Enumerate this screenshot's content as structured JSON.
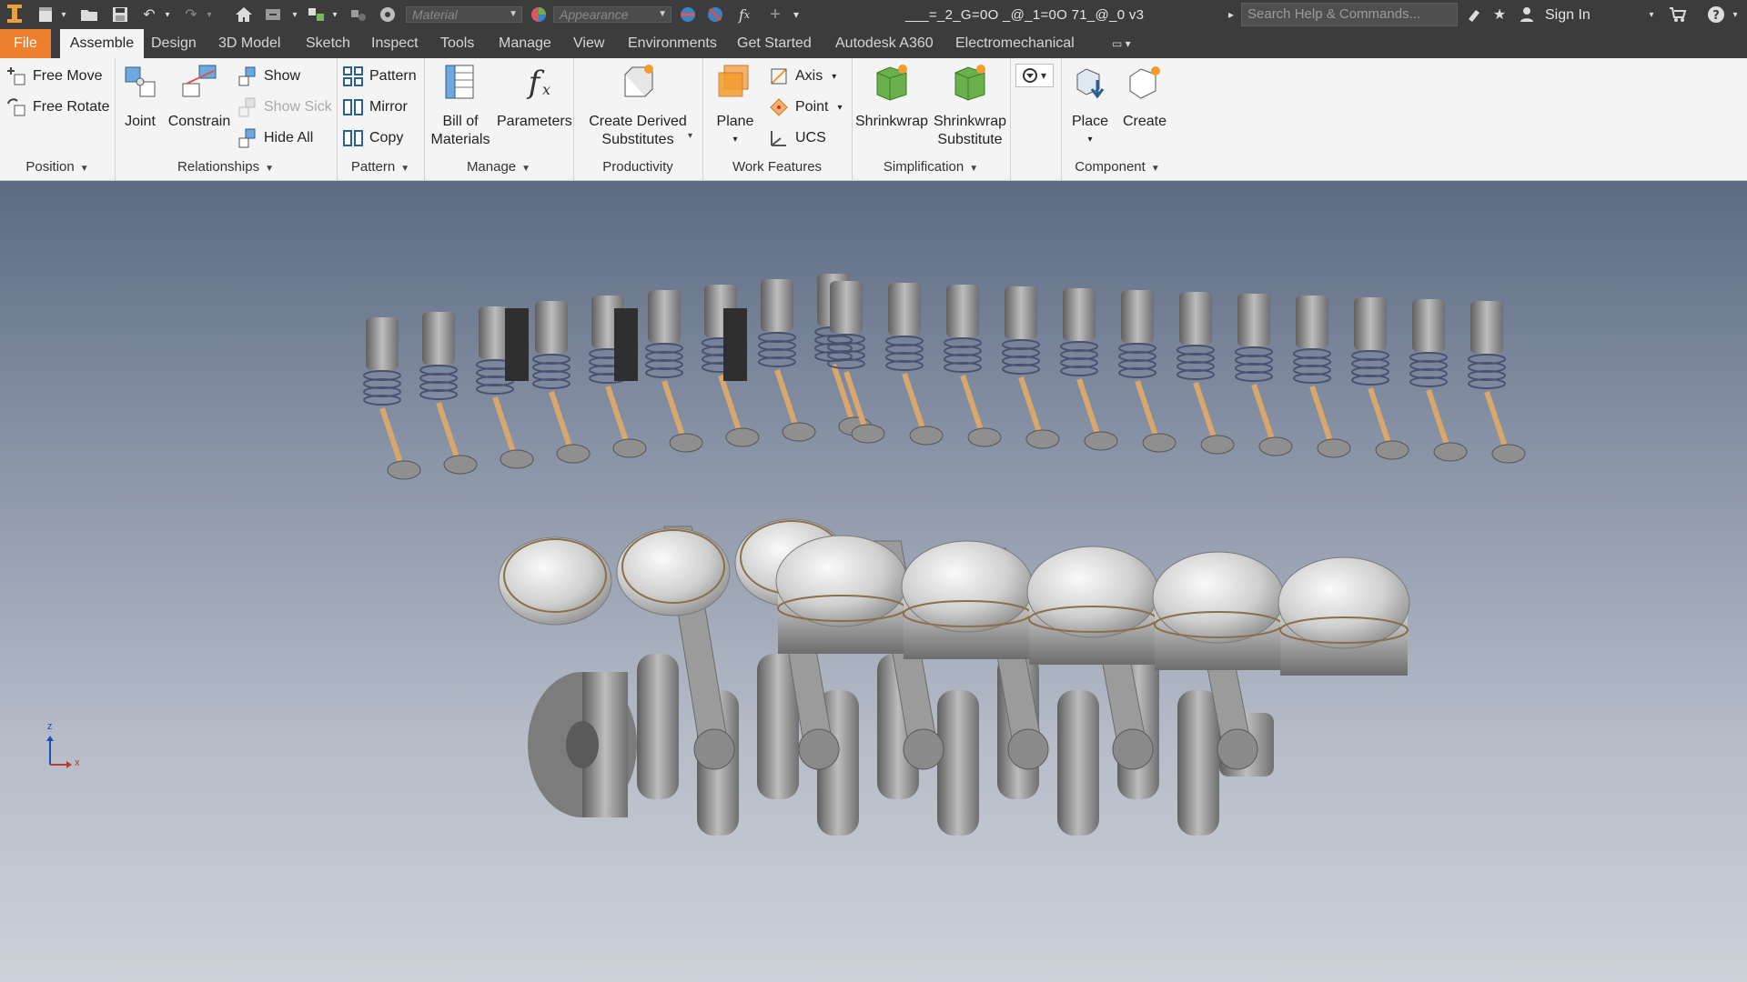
{
  "app": {
    "name": "Autodesk Inventor Professional"
  },
  "qat": {
    "material_placeholder": "Material",
    "appearance_placeholder": "Appearance",
    "document_title": "___=_2_G=0O _@_1=0O 71_@_0 v3",
    "search_placeholder": "Search Help & Commands...",
    "sign_in_label": "Sign In"
  },
  "tabs": [
    {
      "label": "File"
    },
    {
      "label": "Assemble"
    },
    {
      "label": "Design"
    },
    {
      "label": "3D Model"
    },
    {
      "label": "Sketch"
    },
    {
      "label": "Inspect"
    },
    {
      "label": "Tools"
    },
    {
      "label": "Manage"
    },
    {
      "label": "View"
    },
    {
      "label": "Environments"
    },
    {
      "label": "Get Started"
    },
    {
      "label": "Autodesk A360"
    },
    {
      "label": "Electromechanical"
    }
  ],
  "active_tab": "Assemble",
  "ribbon": {
    "position": {
      "title": "Position",
      "free_move": "Free Move",
      "free_rotate": "Free Rotate"
    },
    "relationships": {
      "title": "Relationships",
      "joint": "Joint",
      "constrain": "Constrain",
      "show": "Show",
      "show_sick": "Show Sick",
      "hide_all": "Hide All"
    },
    "pattern": {
      "title": "Pattern",
      "pattern": "Pattern",
      "mirror": "Mirror",
      "copy": "Copy"
    },
    "manage": {
      "title": "Manage",
      "bom_line1": "Bill of",
      "bom_line2": "Materials",
      "parameters": "Parameters"
    },
    "productivity": {
      "title": "Productivity",
      "cds_line1": "Create Derived",
      "cds_line2": "Substitutes"
    },
    "work_features": {
      "title": "Work Features",
      "plane": "Plane",
      "axis": "Axis",
      "point": "Point",
      "ucs": "UCS"
    },
    "simplification": {
      "title": "Simplification",
      "shrinkwrap": "Shrinkwrap",
      "sws_line1": "Shrinkwrap",
      "sws_line2": "Substitute"
    },
    "component": {
      "title": "Component",
      "place": "Place",
      "create": "Create"
    }
  },
  "viewport": {
    "triad": {
      "z": "z",
      "x": "x"
    }
  },
  "colors": {
    "file_tab": "#ee7f2d",
    "ribbon_bg": "#f4f4f4",
    "dark_bar": "#3c3c3c",
    "viewport_top": "#5d6a82",
    "viewport_bottom": "#cdd1d8"
  }
}
